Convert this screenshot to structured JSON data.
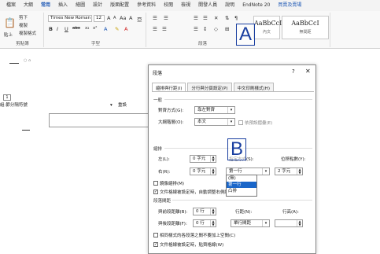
{
  "ribbon_tabs": [
    "檔案",
    "大綱",
    "常用",
    "插入",
    "繪圖",
    "設計",
    "版面配置",
    "參考資料",
    "校閱",
    "檢視",
    "開發人員",
    "說明",
    "EndNote 20",
    "買賣及賣場"
  ],
  "active_tab_index": 2,
  "clipboard": {
    "cut": "剪下",
    "copy": "複製",
    "paste": "貼上",
    "painter": "複製格式",
    "label": "剪貼簿"
  },
  "font": {
    "name": "Times New Roman",
    "size": "12",
    "label": "字型",
    "bold": "B",
    "italic": "I",
    "underline": "U",
    "strike": "abc",
    "sub": "x₂",
    "sup": "x²",
    "grow": "A",
    "shrink": "A",
    "aa": "Aa",
    "clear": "A",
    "phonetic": "亞"
  },
  "paragraph": {
    "label": "段落"
  },
  "styles": [
    {
      "sample": "AaBbCcI",
      "name": "內文"
    },
    {
      "sample": "AaBbCcI",
      "name": "無間距"
    }
  ],
  "doc": {
    "outline_level": "1",
    "nav_combo": "組:節分隔符號",
    "combo_right": "重設"
  },
  "dialog": {
    "title": "段落",
    "help": "?",
    "close": "✕",
    "tabs": [
      "縮排與行距(I)",
      "分行與分頁設定(P)",
      "中文印刷樣式(H)"
    ],
    "general": "一般",
    "alignment_label": "對齊方式(G):",
    "alignment_value": "靠左對齊",
    "outline_label": "大綱階層(O):",
    "outline_value": "本文",
    "collapsed": "依預設摺疊(E)",
    "indent": "縮排",
    "left_label": "左(L):",
    "left_value": "0 字元",
    "right_label": "右(R):",
    "right_value": "0 字元",
    "special_label": "指定方式(S):",
    "special_value": "第一行",
    "by_label": "位移點數(Y):",
    "by_value": "2 字元",
    "mirror": "鏡像縮排(M)",
    "auto_adjust": "文件格線被設定時，自動調整右側縮排(D)",
    "spacing": "段落間距",
    "before_label": "與前段距離(B):",
    "before_value": "0 行",
    "after_label": "與後段距離(F):",
    "after_value": "0 行",
    "line_label": "行距(N):",
    "line_value": "單行間距",
    "at_label": "行高(A):",
    "at_value": "",
    "no_space": "相同樣式的各段落之間不要加上空間(C)",
    "snap_grid": "文件格線被設定時，貼齊格線(W)",
    "dropdown": [
      "(無)",
      "第一行",
      "凸排"
    ],
    "dropdown_selected": 1
  },
  "annotations": {
    "a": "A",
    "b": "B"
  }
}
